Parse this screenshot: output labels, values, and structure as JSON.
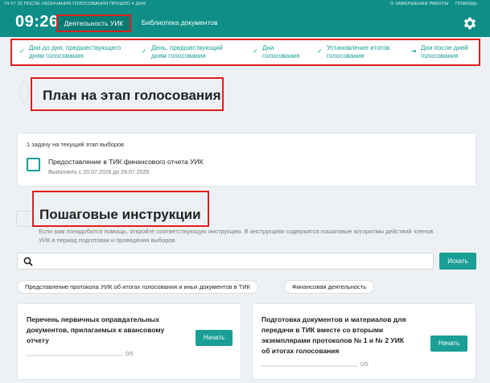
{
  "topbar": {
    "countdown": "74 07 26   ПОСЛЕ ОКОНЧАНИЯ ГОЛОСОВАНИЯ ПРОШЛО 4 ДНЯ",
    "finish_work": "О ЗАВЕРШЕНИИ РАБОТЫ",
    "help": "ПОМОЩЬ"
  },
  "header": {
    "time": "09:26",
    "tab_active": "Деятельность УИК",
    "tab_library": "Библиотека документов",
    "icon": "gear-icon"
  },
  "stages": [
    {
      "label_l1": "Дни до дня, предшествующего",
      "label_l2": "дням голосования",
      "icon": "check-icon"
    },
    {
      "label_l1": "День, предшествующий",
      "label_l2": "дням голосования",
      "icon": "check-icon"
    },
    {
      "label_l1": "Дни",
      "label_l2": "голосования",
      "icon": "check-icon"
    },
    {
      "label_l1": "Установление итогов",
      "label_l2": "голосования",
      "icon": "check-icon"
    },
    {
      "label_l1": "Дни после дней",
      "label_l2": "голосования",
      "icon": "arrow-right-icon"
    }
  ],
  "plan": {
    "title": "План на этап голосования",
    "task_count": "1 задачу на текущий этап выборов",
    "task_title": "Предоставление в ТИК финансового отчета УИК",
    "task_dates": "Выполнить с 20.07.2026 до 29.07.2026"
  },
  "instructions": {
    "title": "Пошаговые инструкции",
    "desc_l1": "Если вам понадобится помощь, откройте соответствующую инструкцию. В инструкциях содержатся пошаговые алгоритмы действий членов",
    "desc_l2": "УИК в период подготовки и проведения выборов",
    "search_placeholder": "",
    "search_button": "Искать",
    "chips": [
      "Представление протокола УИК об итогах голосования и иных документов в ТИК",
      "Финансовая деятельность"
    ]
  },
  "cards": [
    {
      "title_l1": "Перечень первичных оправдательных",
      "title_l2": "документов, прилагаемых к авансовому",
      "title_l3": "отчету",
      "title_l4": "",
      "button": "Начать",
      "progress_text": "0/5",
      "progress": 0
    },
    {
      "title_l1": "Подготовка документов и материалов для",
      "title_l2": "передачи в ТИК вместе со вторыми",
      "title_l3": "экземплярами протоколов № 1 и № 2 УИК",
      "title_l4": "об итогах голосования",
      "button": "Начать",
      "progress_text": "0/5",
      "progress": 0
    }
  ],
  "colors": {
    "brand": "#0e8e86",
    "accent": "#1a9e96",
    "highlight": "#e01e1e"
  }
}
